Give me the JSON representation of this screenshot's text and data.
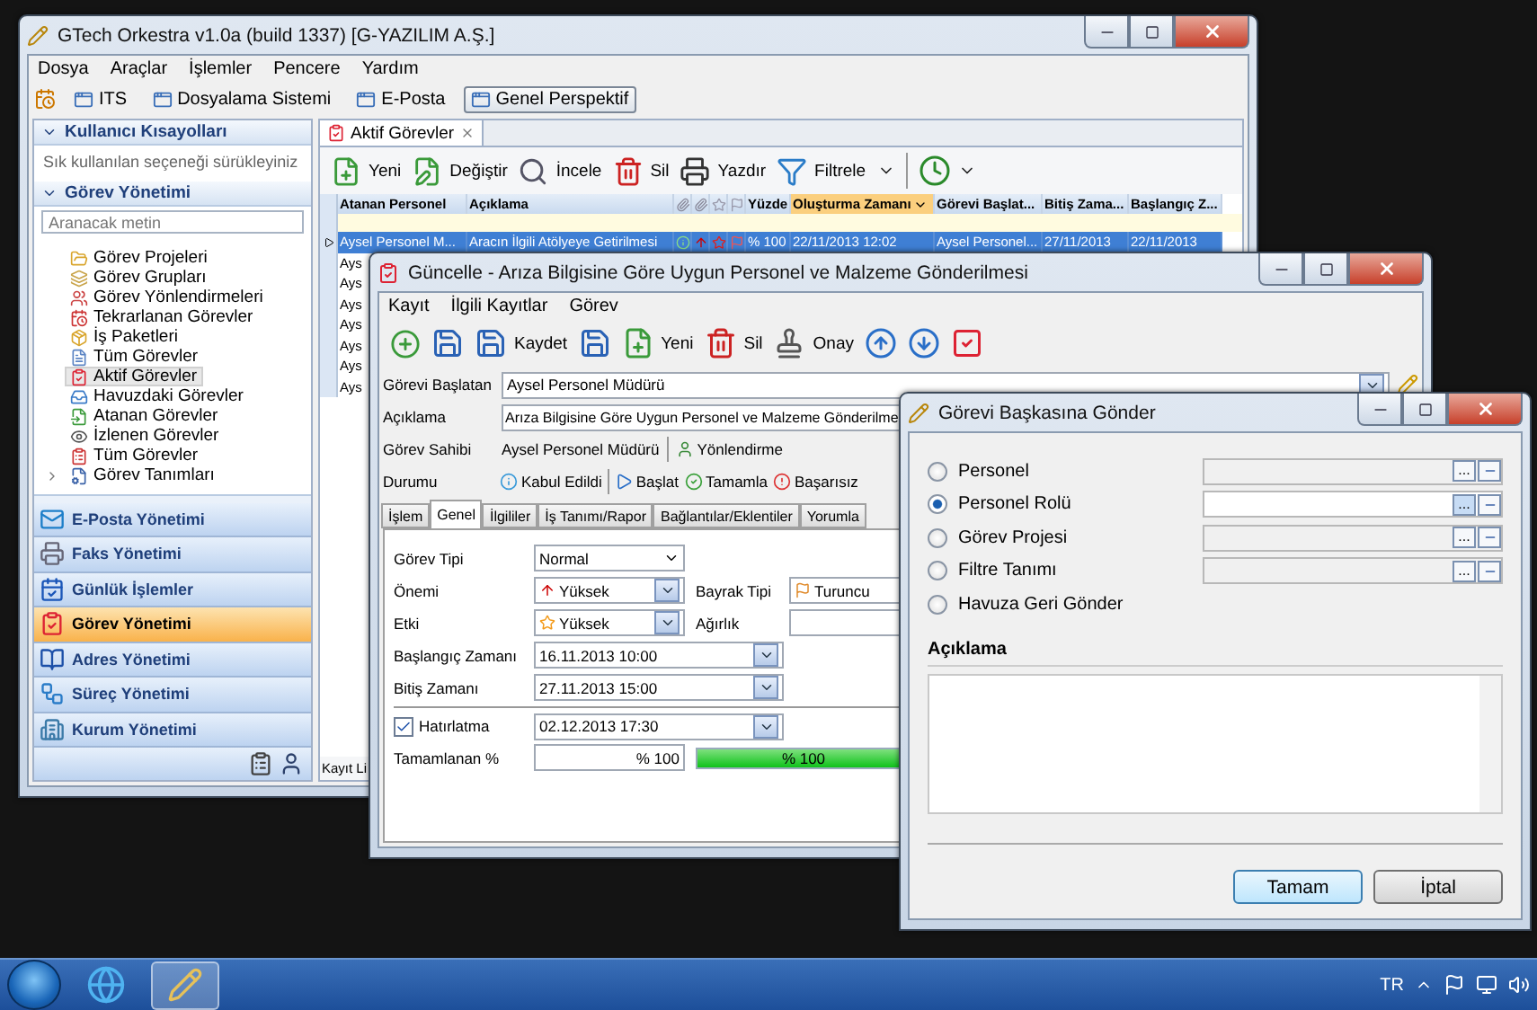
{
  "main_window": {
    "title": "GTech Orkestra v1.0a (build 1337) [G-YAZILIM A.Ş.]",
    "menu": [
      "Dosya",
      "Araçlar",
      "İşlemler",
      "Pencere",
      "Yardım"
    ],
    "quick_bar": [
      {
        "label": "ITS",
        "pressed": false
      },
      {
        "label": "Dosyalama Sistemi",
        "pressed": false
      },
      {
        "label": "E-Posta",
        "pressed": false
      },
      {
        "label": "Genel Perspektif",
        "pressed": true
      }
    ],
    "sidebar": {
      "shortcuts_header": "Kullanıcı Kısayolları",
      "shortcuts_hint": "Sık kullanılan seçeneği sürükleyiniz",
      "tasks_header": "Görev Yönetimi",
      "search": {
        "placeholder": "Aranacak metin"
      },
      "tree": [
        {
          "label": "Görev Projeleri",
          "selected": false,
          "kind": "leaf"
        },
        {
          "label": "Görev Grupları",
          "selected": false,
          "kind": "leaf"
        },
        {
          "label": "Görev Yönlendirmeleri",
          "selected": false,
          "kind": "leaf"
        },
        {
          "label": "Tekrarlanan Görevler",
          "selected": false,
          "kind": "leaf"
        },
        {
          "label": "İş Paketleri",
          "selected": false,
          "kind": "leaf"
        },
        {
          "label": "Tüm Görevler",
          "selected": false,
          "kind": "leaf"
        },
        {
          "label": "Aktif Görevler",
          "selected": true,
          "kind": "leaf"
        },
        {
          "label": "Havuzdaki Görevler",
          "selected": false,
          "kind": "leaf"
        },
        {
          "label": "Atanan Görevler",
          "selected": false,
          "kind": "leaf"
        },
        {
          "label": "İzlenen Görevler",
          "selected": false,
          "kind": "leaf"
        },
        {
          "label": "Tüm Görevler",
          "selected": false,
          "kind": "leaf"
        },
        {
          "label": "Görev Tanımları",
          "selected": false,
          "kind": "group"
        }
      ],
      "modules": [
        {
          "label": "E-Posta Yönetimi",
          "selected": false
        },
        {
          "label": "Faks Yönetimi",
          "selected": false
        },
        {
          "label": "Günlük İşlemler",
          "selected": false
        },
        {
          "label": "Görev Yönetimi",
          "selected": true
        },
        {
          "label": "Adres Yönetimi",
          "selected": false
        },
        {
          "label": "Süreç Yönetimi",
          "selected": false
        },
        {
          "label": "Kurum Yönetimi",
          "selected": false
        }
      ]
    },
    "tab": {
      "label": "Aktif Görevler"
    },
    "toolbar": [
      "Yeni",
      "Değiştir",
      "İncele",
      "Sil",
      "Yazdır",
      "Filtrele"
    ],
    "table": {
      "columns": [
        {
          "kind": "text",
          "label": "Atanan Personel",
          "sorted": false
        },
        {
          "kind": "text",
          "label": "Açıklama",
          "sorted": false
        },
        {
          "kind": "text",
          "label": "Yüzde",
          "sorted": false
        },
        {
          "kind": "text",
          "label": "Oluşturma Zamanı",
          "sorted": true
        },
        {
          "kind": "text",
          "label": "Görevi Başlat...",
          "sorted": false
        },
        {
          "kind": "text",
          "label": "Bitiş Zama...",
          "sorted": false
        },
        {
          "kind": "text",
          "label": "Başlangıç Z...",
          "sorted": false
        }
      ],
      "rows": [
        {
          "selected": true,
          "cells": [
            "Aysel Personel M...",
            "Aracın İlgili Atölyeye Getirilmesi",
            "% 100",
            "22/11/2013 12:02",
            "Aysel Personel...",
            "27/11/2013",
            "22/11/2013"
          ]
        },
        {
          "selected": false,
          "cells": [
            "Ays"
          ]
        },
        {
          "selected": false,
          "cells": [
            "Ays"
          ]
        },
        {
          "selected": false,
          "cells": [
            "Ays"
          ]
        },
        {
          "selected": false,
          "cells": [
            "Ays"
          ]
        },
        {
          "selected": false,
          "cells": [
            "Ays"
          ]
        },
        {
          "selected": false,
          "cells": [
            "Ays"
          ]
        },
        {
          "selected": false,
          "cells": [
            "Ays"
          ]
        }
      ]
    },
    "status": "Kayıt Li"
  },
  "edit_window": {
    "title": "Güncelle - Arıza Bilgisine Göre Uygun Personel ve Malzeme Gönderilmesi",
    "menu": [
      "Kayıt",
      "İlgili Kayıtlar",
      "Görev"
    ],
    "toolbar": [
      "Kaydet",
      "Yeni",
      "Sil",
      "Onay"
    ],
    "initiator": {
      "label": "Görevi Başlatan",
      "value": "Aysel Personel Müdürü"
    },
    "description": {
      "label": "Açıklama",
      "value": "Arıza Bilgisine Göre Uygun Personel ve Malzeme Gönderilme"
    },
    "owner": {
      "label": "Görev Sahibi",
      "value": "Aysel Personel Müdürü",
      "action": "Yönlendirme"
    },
    "state": {
      "label": "Durumu",
      "value": "Kabul Edildi",
      "actions": [
        "Başlat",
        "Tamamla",
        "Başarısız"
      ]
    },
    "tabs": [
      {
        "label": "İşlem",
        "selected": false
      },
      {
        "label": "Genel",
        "selected": true
      },
      {
        "label": "İlgililer",
        "selected": false
      },
      {
        "label": "İş Tanımı/Rapor",
        "selected": false
      },
      {
        "label": "Bağlantılar/Eklentiler",
        "selected": false
      },
      {
        "label": "Yorumla",
        "selected": false
      }
    ],
    "form": {
      "type": {
        "label": "Görev Tipi",
        "value": "Normal"
      },
      "priority": {
        "label": "Önemi",
        "value": "Yüksek"
      },
      "flag": {
        "label": "Bayrak Tipi",
        "value": "Turuncu"
      },
      "impact": {
        "label": "Etki",
        "value": "Yüksek"
      },
      "weight": {
        "label": "Ağırlık"
      },
      "start": {
        "label": "Başlangıç Zamanı",
        "value": "16.11.2013 10:00"
      },
      "end": {
        "label": "Bitiş Zamanı",
        "value": "27.11.2013 15:00"
      },
      "reminder": {
        "label": "Hatırlatma",
        "checked": true,
        "value": "02.12.2013 17:30"
      },
      "progress": {
        "label": "Tamamlanan %",
        "value": "% 100",
        "level": 1,
        "bar_label": "% 100"
      }
    }
  },
  "dialog": {
    "title": "Görevi Başkasına Gönder",
    "options": [
      {
        "label": "Personel",
        "selected": false,
        "kind": "field",
        "browse": "..."
      },
      {
        "label": "Personel Rolü",
        "selected": true,
        "kind": "field",
        "browse": "..."
      },
      {
        "label": "Görev Projesi",
        "selected": false,
        "kind": "field",
        "browse": "..."
      },
      {
        "label": "Filtre Tanımı",
        "selected": false,
        "kind": "field",
        "browse": "..."
      },
      {
        "label": "Havuza Geri Gönder",
        "selected": false,
        "kind": "plain"
      }
    ],
    "note_label": "Açıklama",
    "buttons": [
      {
        "label": "Tamam",
        "default": true
      },
      {
        "label": "İptal",
        "default": false
      }
    ]
  },
  "taskbar": {
    "language": "TR"
  }
}
